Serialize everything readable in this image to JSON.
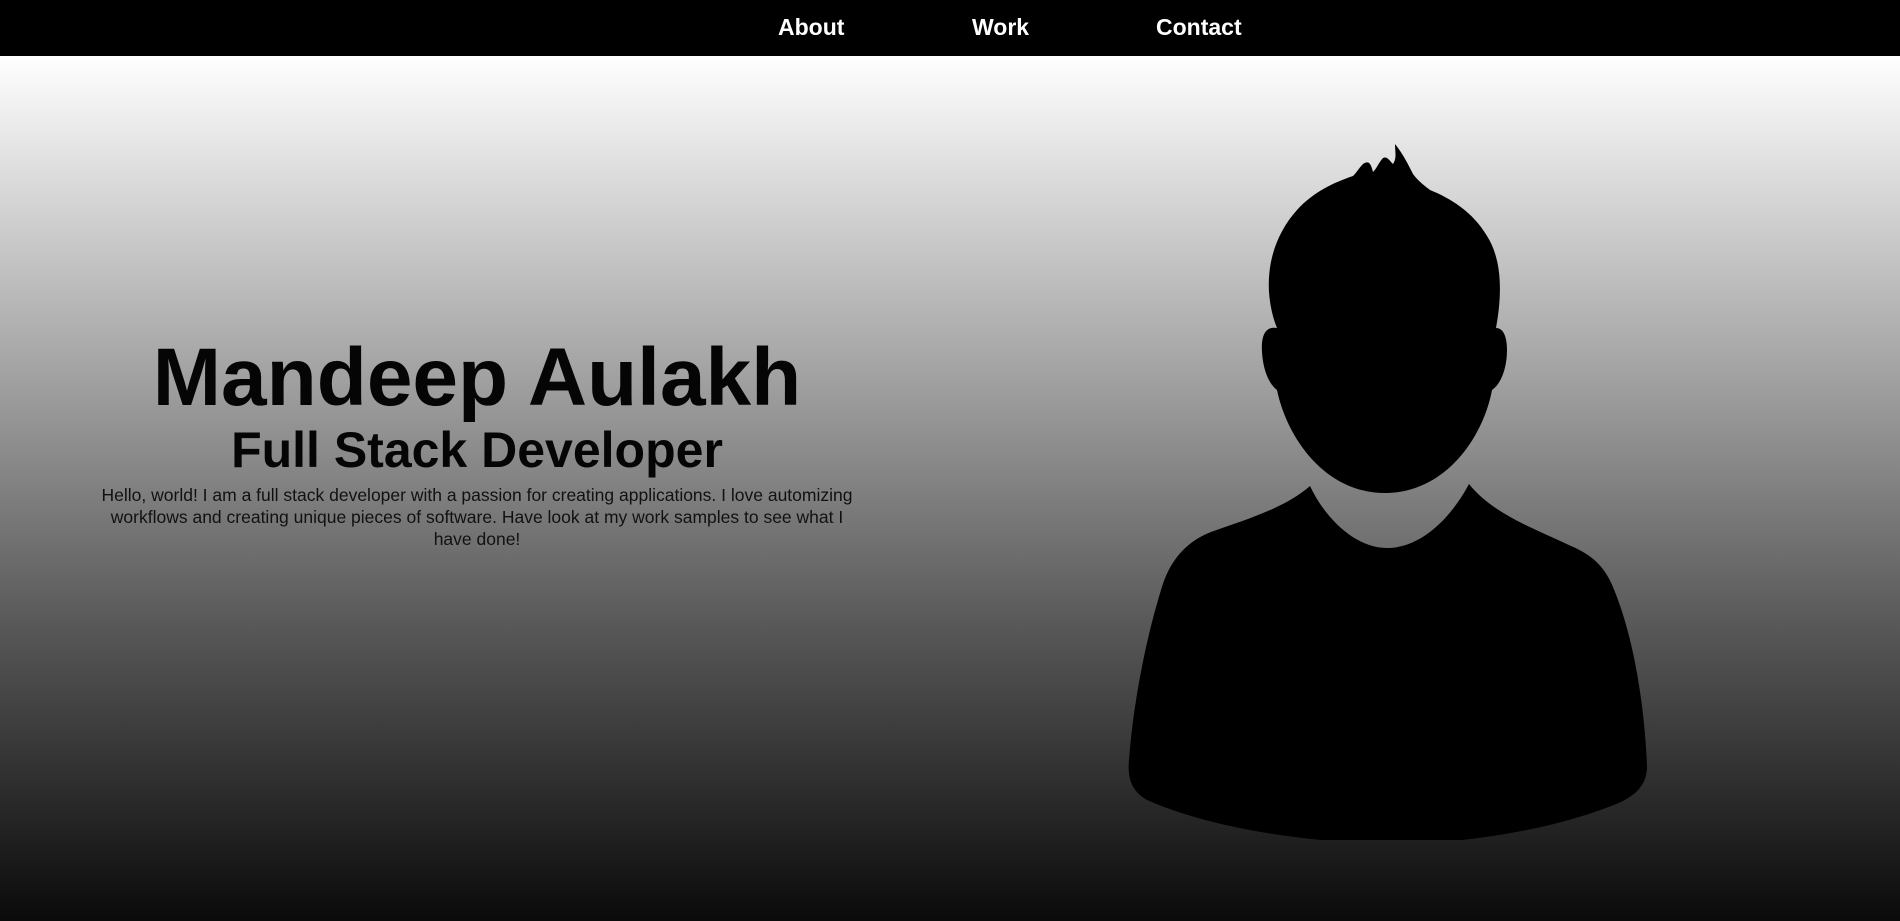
{
  "nav": {
    "items": [
      {
        "label": "About"
      },
      {
        "label": "Work"
      },
      {
        "label": "Contact"
      }
    ]
  },
  "hero": {
    "name": "Mandeep Aulakh",
    "role": "Full Stack Developer",
    "bio": "Hello, world! I am a full stack developer with a passion for creating applications. I love automizing workflows and creating unique pieces of software. Have look at my work samples to see what I have done!",
    "avatar_icon": "person-silhouette-icon"
  },
  "colors": {
    "nav_background": "#000000",
    "nav_text": "#ffffff",
    "gradient_top": "#ffffff",
    "gradient_bottom": "#0a0a0a",
    "silhouette": "#000000"
  }
}
